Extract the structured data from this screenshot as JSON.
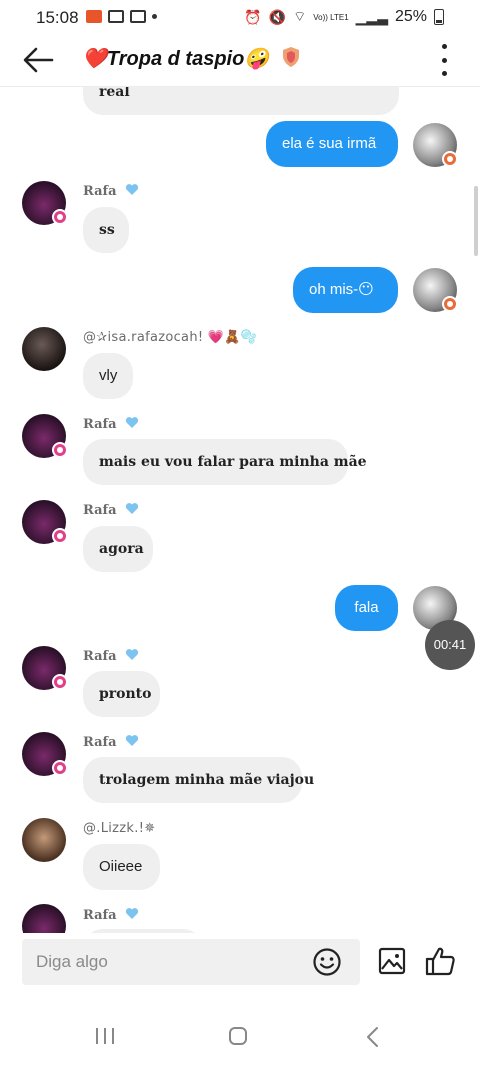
{
  "status_bar": {
    "time": "15:08",
    "battery": "25%",
    "network": "Vo)) LTE1"
  },
  "header": {
    "title": "❤️Tropa d taspio🤪"
  },
  "messages": [
    {
      "type": "in",
      "text": "real"
    },
    {
      "type": "out",
      "text": "ela é sua irmã"
    },
    {
      "type": "in",
      "sender": "Rafa",
      "text": "ss"
    },
    {
      "type": "out",
      "text": "oh mis-😶"
    },
    {
      "type": "in",
      "sender": "@✰isa.rafazocah! 💗🧸🫧",
      "text": "vly"
    },
    {
      "type": "in",
      "sender": "Rafa",
      "text": "mais eu vou falar para minha mãe"
    },
    {
      "type": "in",
      "sender": "Rafa",
      "text": "agora"
    },
    {
      "type": "out",
      "text": "fala"
    },
    {
      "type": "in",
      "sender": "Rafa",
      "text": "pronto"
    },
    {
      "type": "in",
      "sender": "Rafa",
      "text": "trolagem minha mãe viajou"
    },
    {
      "type": "in",
      "sender": "@.Lizzk.!✵",
      "text": "Oiieee"
    },
    {
      "type": "in",
      "sender": "Rafa",
      "text": ""
    }
  ],
  "timer": "00:41",
  "composer": {
    "placeholder": "Diga algo"
  },
  "icons": {
    "back": "arrow-left-icon",
    "menu": "kebab-icon",
    "emoji": "emoji-icon",
    "image": "image-icon",
    "like": "thumbs-up-icon"
  },
  "colors": {
    "outgoing": "#2196f3",
    "incoming": "#efefef",
    "badge": "#e0408a"
  }
}
